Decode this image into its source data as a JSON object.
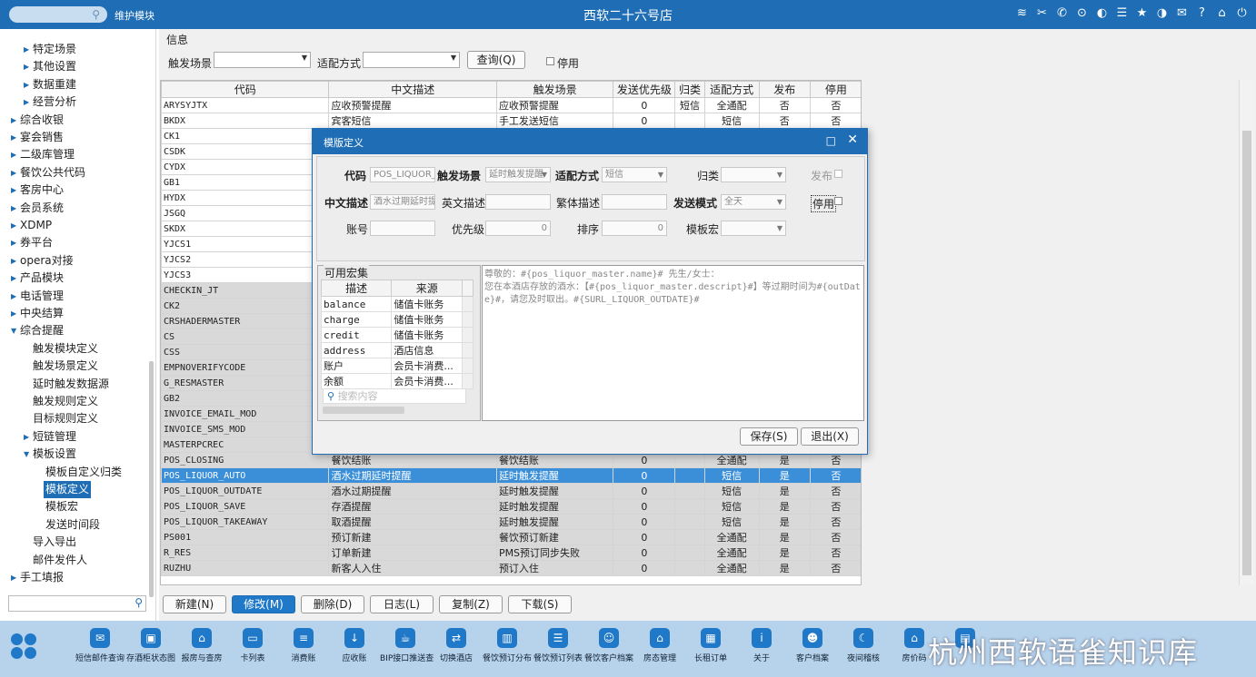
{
  "header": {
    "search_icon": "search-icon",
    "module": "维护模块",
    "title": "西软二十六号店",
    "icons": [
      "wifi-icon",
      "tools-icon",
      "phone-icon",
      "lock-icon",
      "palette-icon",
      "menu-icon",
      "star-icon",
      "moon-icon",
      "mail-icon",
      "help-icon",
      "home-icon",
      "power-icon"
    ]
  },
  "sidebar": {
    "items": [
      {
        "label": "特定场景",
        "level": 2,
        "arrow": true
      },
      {
        "label": "其他设置",
        "level": 2,
        "arrow": true
      },
      {
        "label": "数据重建",
        "level": 2,
        "arrow": true
      },
      {
        "label": "经营分析",
        "level": 2,
        "arrow": true
      },
      {
        "label": "综合收银",
        "level": 1,
        "arrow": true
      },
      {
        "label": "宴会销售",
        "level": 1,
        "arrow": true
      },
      {
        "label": "二级库管理",
        "level": 1,
        "arrow": true
      },
      {
        "label": "餐饮公共代码",
        "level": 1,
        "arrow": true
      },
      {
        "label": "客房中心",
        "level": 1,
        "arrow": true
      },
      {
        "label": "会员系统",
        "level": 1,
        "arrow": true
      },
      {
        "label": "XDMP",
        "level": 1,
        "arrow": true
      },
      {
        "label": "券平台",
        "level": 1,
        "arrow": true
      },
      {
        "label": "opera对接",
        "level": 1,
        "arrow": true
      },
      {
        "label": "产品模块",
        "level": 1,
        "arrow": true
      },
      {
        "label": "电话管理",
        "level": 1,
        "arrow": true
      },
      {
        "label": "中央结算",
        "level": 1,
        "arrow": true
      },
      {
        "label": "综合提醒",
        "level": 1,
        "arrow": true,
        "open": true
      },
      {
        "label": "触发模块定义",
        "level": 2
      },
      {
        "label": "触发场景定义",
        "level": 2
      },
      {
        "label": "延时触发数据源",
        "level": 2
      },
      {
        "label": "触发规则定义",
        "level": 2
      },
      {
        "label": "目标规则定义",
        "level": 2
      },
      {
        "label": "短链管理",
        "level": 2,
        "arrow": true
      },
      {
        "label": "模板设置",
        "level": 2,
        "arrow": true,
        "open": true
      },
      {
        "label": "模板自定义归类",
        "level": 3
      },
      {
        "label": "模板定义",
        "level": 3,
        "selected": true
      },
      {
        "label": "模板宏",
        "level": 3
      },
      {
        "label": "发送时间段",
        "level": 3
      },
      {
        "label": "导入导出",
        "level": 2
      },
      {
        "label": "邮件发件人",
        "level": 2
      },
      {
        "label": "手工填报",
        "level": 1,
        "arrow": true
      }
    ],
    "search_icon": "search-icon"
  },
  "filters": {
    "section": "信息",
    "scene_label": "触发场景",
    "match_label": "适配方式",
    "query": "查询(Q)",
    "disabled_label": "停用"
  },
  "grid": {
    "columns": [
      "代码",
      "中文描述",
      "触发场景",
      "发送优先级",
      "归类",
      "适配方式",
      "发布",
      "停用"
    ],
    "rows": [
      {
        "code": "ARYSYJTX",
        "desc": "应收预警提醒",
        "scene": "应收预警提醒",
        "pri": "0",
        "cat": "短信",
        "match": "全通配",
        "pub": "否",
        "dis": "否",
        "style": ""
      },
      {
        "code": "BKDX",
        "desc": "宾客短信",
        "scene": "手工发送短信",
        "pri": "0",
        "cat": "",
        "match": "短信",
        "pub": "否",
        "dis": "否",
        "style": ""
      },
      {
        "code": "CK1",
        "desc": "",
        "scene": "",
        "pri": "",
        "cat": "",
        "match": "",
        "pub": "",
        "dis": "",
        "style": ""
      },
      {
        "code": "CSDK",
        "desc": "",
        "scene": "",
        "pri": "",
        "cat": "",
        "match": "",
        "pub": "",
        "dis": "",
        "style": ""
      },
      {
        "code": "CYDX",
        "desc": "",
        "scene": "",
        "pri": "",
        "cat": "",
        "match": "",
        "pub": "",
        "dis": "",
        "style": ""
      },
      {
        "code": "GB1",
        "desc": "",
        "scene": "",
        "pri": "",
        "cat": "",
        "match": "",
        "pub": "",
        "dis": "",
        "style": ""
      },
      {
        "code": "HYDX",
        "desc": "",
        "scene": "",
        "pri": "",
        "cat": "",
        "match": "",
        "pub": "",
        "dis": "",
        "style": ""
      },
      {
        "code": "JSGQ",
        "desc": "",
        "scene": "",
        "pri": "",
        "cat": "",
        "match": "",
        "pub": "",
        "dis": "",
        "style": ""
      },
      {
        "code": "SKDX",
        "desc": "",
        "scene": "",
        "pri": "",
        "cat": "",
        "match": "",
        "pub": "",
        "dis": "",
        "style": ""
      },
      {
        "code": "YJCS1",
        "desc": "",
        "scene": "",
        "pri": "",
        "cat": "",
        "match": "",
        "pub": "",
        "dis": "",
        "style": ""
      },
      {
        "code": "YJCS2",
        "desc": "",
        "scene": "",
        "pri": "",
        "cat": "",
        "match": "",
        "pub": "",
        "dis": "",
        "style": ""
      },
      {
        "code": "YJCS3",
        "desc": "",
        "scene": "",
        "pri": "",
        "cat": "",
        "match": "",
        "pub": "",
        "dis": "",
        "style": ""
      },
      {
        "code": "CHECKIN_JT",
        "desc": "",
        "scene": "",
        "pri": "",
        "cat": "",
        "match": "",
        "pub": "",
        "dis": "",
        "style": "gray"
      },
      {
        "code": "CK2",
        "desc": "",
        "scene": "",
        "pri": "",
        "cat": "",
        "match": "",
        "pub": "",
        "dis": "",
        "style": "gray"
      },
      {
        "code": "CRSHADERMASTER",
        "desc": "",
        "scene": "",
        "pri": "",
        "cat": "",
        "match": "",
        "pub": "",
        "dis": "",
        "style": "gray"
      },
      {
        "code": "CS",
        "desc": "",
        "scene": "",
        "pri": "",
        "cat": "",
        "match": "",
        "pub": "",
        "dis": "",
        "style": "gray"
      },
      {
        "code": "CSS",
        "desc": "",
        "scene": "",
        "pri": "",
        "cat": "",
        "match": "",
        "pub": "",
        "dis": "",
        "style": "gray"
      },
      {
        "code": "EMPNOVERIFYCODE",
        "desc": "",
        "scene": "",
        "pri": "",
        "cat": "",
        "match": "",
        "pub": "",
        "dis": "",
        "style": "gray"
      },
      {
        "code": "G_RESMASTER",
        "desc": "",
        "scene": "",
        "pri": "",
        "cat": "",
        "match": "",
        "pub": "",
        "dis": "",
        "style": "gray"
      },
      {
        "code": "GB2",
        "desc": "",
        "scene": "",
        "pri": "",
        "cat": "",
        "match": "",
        "pub": "",
        "dis": "",
        "style": "gray"
      },
      {
        "code": "INVOICE_EMAIL_MOD",
        "desc": "",
        "scene": "",
        "pri": "",
        "cat": "",
        "match": "",
        "pub": "",
        "dis": "",
        "style": "gray"
      },
      {
        "code": "INVOICE_SMS_MOD",
        "desc": "",
        "scene": "",
        "pri": "",
        "cat": "",
        "match": "",
        "pub": "",
        "dis": "",
        "style": "gray"
      },
      {
        "code": "MASTERPCREC",
        "desc": "",
        "scene": "",
        "pri": "",
        "cat": "",
        "match": "",
        "pub": "",
        "dis": "",
        "style": "gray"
      },
      {
        "code": "POS_CLOSING",
        "desc": "餐饮结账",
        "scene": "餐饮结账",
        "pri": "0",
        "cat": "",
        "match": "全通配",
        "pub": "是",
        "dis": "否",
        "style": "gray"
      },
      {
        "code": "POS_LIQUOR_AUTO",
        "desc": "酒水过期延时提醒",
        "scene": "延时触发提醒",
        "pri": "0",
        "cat": "",
        "match": "短信",
        "pub": "是",
        "dis": "否",
        "style": "sel"
      },
      {
        "code": "POS_LIQUOR_OUTDATE",
        "desc": "酒水过期提醒",
        "scene": "延时触发提醒",
        "pri": "0",
        "cat": "",
        "match": "短信",
        "pub": "是",
        "dis": "否",
        "style": "gray"
      },
      {
        "code": "POS_LIQUOR_SAVE",
        "desc": "存酒提醒",
        "scene": "延时触发提醒",
        "pri": "0",
        "cat": "",
        "match": "短信",
        "pub": "是",
        "dis": "否",
        "style": "gray"
      },
      {
        "code": "POS_LIQUOR_TAKEAWAY",
        "desc": "取酒提醒",
        "scene": "延时触发提醒",
        "pri": "0",
        "cat": "",
        "match": "短信",
        "pub": "是",
        "dis": "否",
        "style": "gray"
      },
      {
        "code": "PS001",
        "desc": "预订新建",
        "scene": "餐饮预订新建",
        "pri": "0",
        "cat": "",
        "match": "全通配",
        "pub": "是",
        "dis": "否",
        "style": "gray"
      },
      {
        "code": "R_RES",
        "desc": "订单新建",
        "scene": "PMS预订同步失败",
        "pri": "0",
        "cat": "",
        "match": "全通配",
        "pub": "是",
        "dis": "否",
        "style": "gray"
      },
      {
        "code": "RUZHU",
        "desc": "新客人入住",
        "scene": "预订入住",
        "pri": "0",
        "cat": "",
        "match": "全通配",
        "pub": "是",
        "dis": "否",
        "style": "gray"
      }
    ]
  },
  "actions": [
    "新建(N)",
    "修改(M)",
    "删除(D)",
    "日志(L)",
    "复制(Z)",
    "下载(S)"
  ],
  "dialog": {
    "title": "模版定义",
    "labels": {
      "code": "代码",
      "scene": "触发场景",
      "match": "适配方式",
      "cat": "归类",
      "publish": "发布",
      "cn": "中文描述",
      "en": "英文描述",
      "tw": "繁体描述",
      "send_mode": "发送模式",
      "disabled": "停用",
      "account": "账号",
      "priority": "优先级",
      "sort": "排序",
      "macro": "模板宏"
    },
    "values": {
      "code": "POS_LIQUOR_AUTO",
      "scene": "延时触发提醒",
      "match": "短信",
      "cn": "酒水过期延时提醒",
      "send_mode": "全天",
      "priority": "0",
      "sort": "0"
    },
    "macro_panel": {
      "title": "可用宏集",
      "cols": [
        "描述",
        "来源"
      ],
      "rows": [
        [
          "balance",
          "储值卡账务"
        ],
        [
          "charge",
          "储值卡账务"
        ],
        [
          "credit",
          "储值卡账务"
        ],
        [
          "address",
          "酒店信息"
        ],
        [
          "账户",
          "会员卡消费..."
        ],
        [
          "余额",
          "会员卡消费..."
        ]
      ],
      "search_placeholder": "搜索内容"
    },
    "template_text": "尊敬的：#{pos_liquor_master.name}# 先生/女士：\n您在本酒店存放的酒水：【#{pos_liquor_master.descript}#】等过期时间为#{outDate}#，请您及时取出。#{SURL_LIQUOR_OUTDATE}#",
    "save": "保存(S)",
    "exit": "退出(X)"
  },
  "taskbar": {
    "items": [
      {
        "label": "短信邮件查询",
        "icon": "mail-icon"
      },
      {
        "label": "存酒柜状态图",
        "icon": "cabinet-icon"
      },
      {
        "label": "报房与查房",
        "icon": "house-icon"
      },
      {
        "label": "卡列表",
        "icon": "card-icon"
      },
      {
        "label": "消费账",
        "icon": "bill-icon"
      },
      {
        "label": "应收账",
        "icon": "download-icon"
      },
      {
        "label": "BIP接口推送查",
        "icon": "cup-icon"
      },
      {
        "label": "切换酒店",
        "icon": "switch-icon"
      },
      {
        "label": "餐饮预订分布",
        "icon": "chart-icon"
      },
      {
        "label": "餐饮预订列表",
        "icon": "list-icon"
      },
      {
        "label": "餐饮客户档案",
        "icon": "person-icon"
      },
      {
        "label": "房态管理",
        "icon": "house-icon"
      },
      {
        "label": "长租订单",
        "icon": "building-icon"
      },
      {
        "label": "关于",
        "icon": "info-icon"
      },
      {
        "label": "客户档案",
        "icon": "profile-icon"
      },
      {
        "label": "夜间稽核",
        "icon": "moon-icon"
      },
      {
        "label": "房价码",
        "icon": "tag-icon"
      },
      {
        "label": "",
        "icon": "grid-icon"
      }
    ],
    "watermark": "杭州西软语雀知识库"
  }
}
